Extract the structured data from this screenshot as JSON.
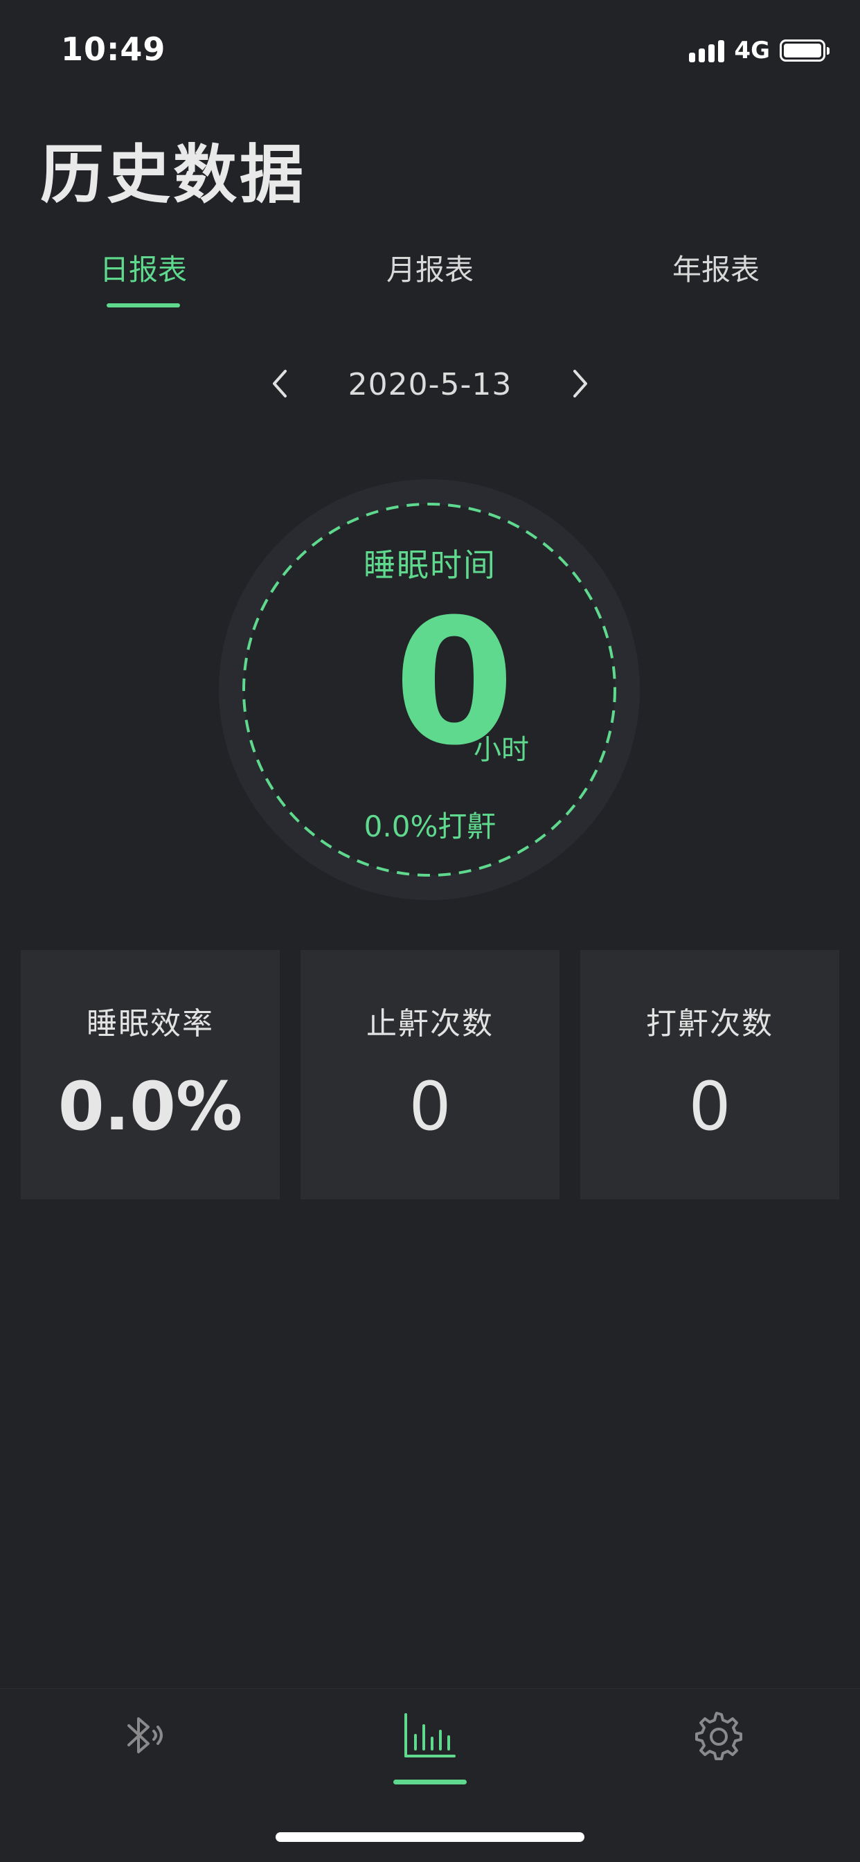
{
  "status_bar": {
    "time": "10:49",
    "network": "4G"
  },
  "page": {
    "title": "历史数据"
  },
  "tabs": [
    {
      "label": "日报表",
      "active": true
    },
    {
      "label": "月报表",
      "active": false
    },
    {
      "label": "年报表",
      "active": false
    }
  ],
  "date_nav": {
    "date": "2020-5-13",
    "prev_icon": "chevron-left-icon",
    "next_icon": "chevron-right-icon"
  },
  "summary": {
    "title": "睡眠时间",
    "value": "0",
    "unit": "小时",
    "snore_text": "0.0%打鼾"
  },
  "stats": [
    {
      "label": "睡眠效率",
      "value": "0.0%"
    },
    {
      "label": "止鼾次数",
      "value": "0"
    },
    {
      "label": "打鼾次数",
      "value": "0"
    }
  ],
  "bottom_nav": [
    {
      "icon": "bluetooth-icon",
      "active": false
    },
    {
      "icon": "bar-chart-icon",
      "active": true
    },
    {
      "icon": "gear-icon",
      "active": false
    }
  ],
  "colors": {
    "background": "#222326",
    "accent": "#5fd98e",
    "card": "#2c2d30"
  }
}
